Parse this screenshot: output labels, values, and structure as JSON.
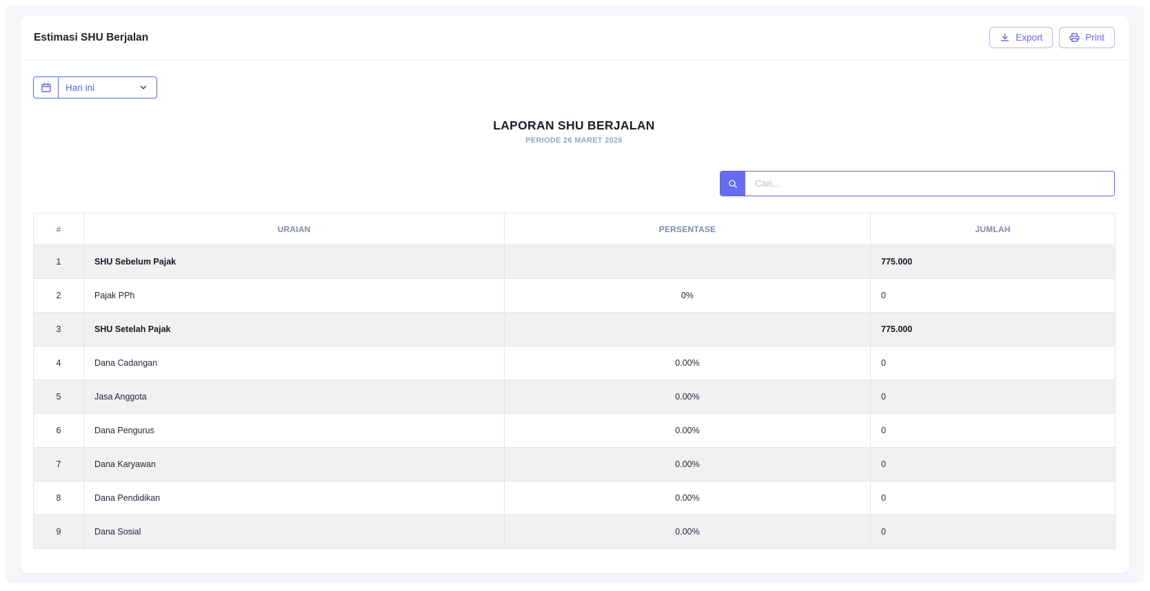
{
  "colors": {
    "accent": "#5b63e6",
    "accent_fill": "#666bf2",
    "button_text": "#5f66ee",
    "stripe": "#f1f1f2",
    "table_header_text": "#7e8bab",
    "page_background": "#f5f6f9"
  },
  "header": {
    "title": "Estimasi SHU Berjalan",
    "export_label": "Export",
    "print_label": "Print"
  },
  "filter": {
    "selected": "Hari ini",
    "calendar_icon": "calendar-icon",
    "chevron_icon": "chevron-down-icon"
  },
  "report": {
    "title": "LAPORAN SHU BERJALAN",
    "subtitle": "PERIODE 26 MARET 2026"
  },
  "search": {
    "placeholder": "Cari...",
    "value": "",
    "icon": "search-icon"
  },
  "table": {
    "columns": [
      "#",
      "URAIAN",
      "PERSENTASE",
      "JUMLAH"
    ],
    "rows": [
      {
        "no": "1",
        "uraian": "SHU Sebelum Pajak",
        "persentase": "",
        "jumlah": "775.000",
        "bold": true
      },
      {
        "no": "2",
        "uraian": "Pajak PPh",
        "persentase": "0%",
        "jumlah": "0",
        "bold": false
      },
      {
        "no": "3",
        "uraian": "SHU Setelah Pajak",
        "persentase": "",
        "jumlah": "775.000",
        "bold": true
      },
      {
        "no": "4",
        "uraian": "Dana Cadangan",
        "persentase": "0.00%",
        "jumlah": "0",
        "bold": false
      },
      {
        "no": "5",
        "uraian": "Jasa Anggota",
        "persentase": "0.00%",
        "jumlah": "0",
        "bold": false
      },
      {
        "no": "6",
        "uraian": "Dana Pengurus",
        "persentase": "0.00%",
        "jumlah": "0",
        "bold": false
      },
      {
        "no": "7",
        "uraian": "Dana Karyawan",
        "persentase": "0.00%",
        "jumlah": "0",
        "bold": false
      },
      {
        "no": "8",
        "uraian": "Dana Pendidikan",
        "persentase": "0.00%",
        "jumlah": "0",
        "bold": false
      },
      {
        "no": "9",
        "uraian": "Dana Sosial",
        "persentase": "0.00%",
        "jumlah": "0",
        "bold": false
      }
    ]
  }
}
